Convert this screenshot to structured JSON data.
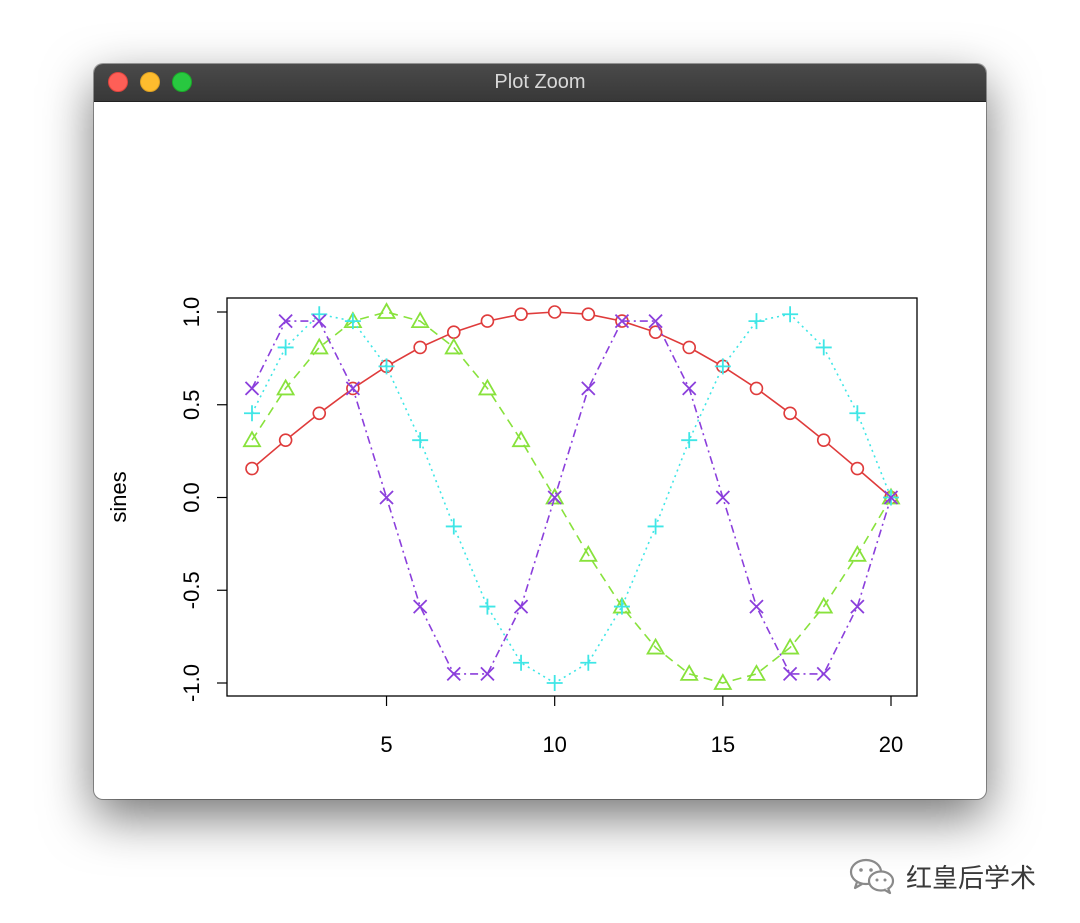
{
  "window": {
    "title": "Plot Zoom"
  },
  "watermark": {
    "text": "红皇后学术"
  },
  "colors": {
    "red": "#df3b3b",
    "green": "#88e23c",
    "cyan": "#3fe6e6",
    "purple": "#8b3fdc"
  },
  "chart_data": {
    "type": "line",
    "title": "",
    "xlabel": "",
    "ylabel": "sines",
    "xlim": [
      1,
      20
    ],
    "ylim": [
      -1,
      1
    ],
    "xticks": [
      5,
      10,
      15,
      20
    ],
    "yticks": [
      -1.0,
      -0.5,
      0.0,
      0.5,
      1.0
    ],
    "ytick_labels": [
      "-1.0",
      "-0.5",
      "0.0",
      "0.5",
      "1.0"
    ],
    "x": [
      1,
      2,
      3,
      4,
      5,
      6,
      7,
      8,
      9,
      10,
      11,
      12,
      13,
      14,
      15,
      16,
      17,
      18,
      19,
      20
    ],
    "series": [
      {
        "color": "#df3b3b",
        "linestyle": "solid",
        "marker": "circle",
        "values": [
          0.156,
          0.309,
          0.454,
          0.588,
          0.707,
          0.809,
          0.891,
          0.951,
          0.988,
          1.0,
          0.988,
          0.951,
          0.891,
          0.809,
          0.707,
          0.588,
          0.454,
          0.309,
          0.156,
          0.0
        ]
      },
      {
        "color": "#88e23c",
        "linestyle": "dashed",
        "marker": "triangle",
        "values": [
          0.309,
          0.588,
          0.809,
          0.951,
          1.0,
          0.951,
          0.809,
          0.588,
          0.309,
          0.0,
          -0.309,
          -0.588,
          -0.809,
          -0.951,
          -1.0,
          -0.951,
          -0.809,
          -0.588,
          -0.309,
          0.0
        ]
      },
      {
        "color": "#3fe6e6",
        "linestyle": "dotted",
        "marker": "plus",
        "values": [
          0.454,
          0.809,
          0.988,
          0.951,
          0.707,
          0.309,
          -0.156,
          -0.588,
          -0.891,
          -1.0,
          -0.891,
          -0.588,
          -0.156,
          0.309,
          0.707,
          0.951,
          0.988,
          0.809,
          0.454,
          0.0
        ]
      },
      {
        "color": "#8b3fdc",
        "linestyle": "dashdot",
        "marker": "x",
        "values": [
          0.588,
          0.951,
          0.951,
          0.588,
          0.0,
          -0.588,
          -0.951,
          -0.951,
          -0.588,
          0.0,
          0.588,
          0.951,
          0.951,
          0.588,
          0.0,
          -0.588,
          -0.951,
          -0.951,
          -0.588,
          0.0
        ]
      }
    ]
  }
}
